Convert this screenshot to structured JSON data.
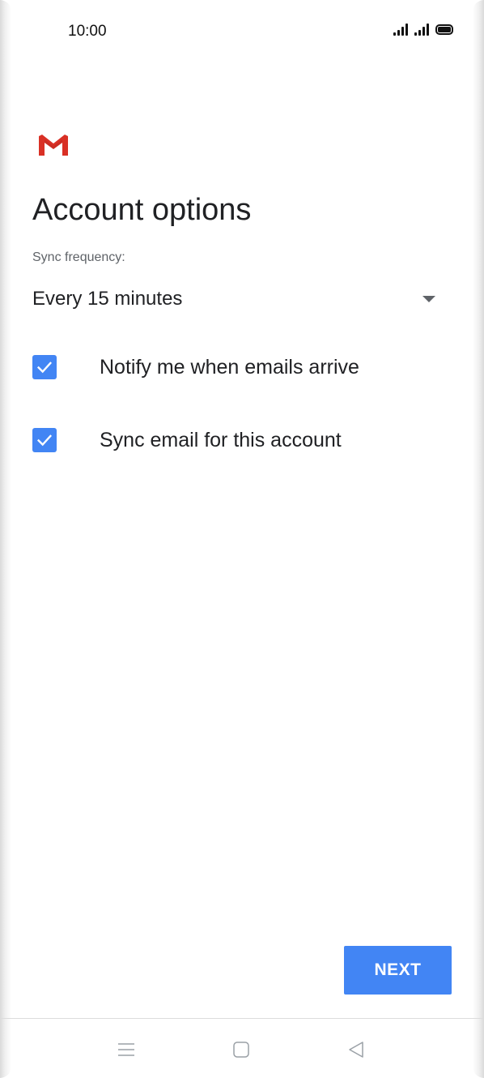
{
  "status_bar": {
    "time": "10:00"
  },
  "app": {
    "logo_icon": "gmail-icon",
    "title": "Account options"
  },
  "sync": {
    "label": "Sync frequency:",
    "selected": "Every 15 minutes"
  },
  "options": [
    {
      "label": "Notify me when emails arrive",
      "checked": true
    },
    {
      "label": "Sync email for this account",
      "checked": true
    }
  ],
  "actions": {
    "next_label": "NEXT"
  },
  "colors": {
    "accent": "#4285f4",
    "gmail_red": "#d93025",
    "text_primary": "#202124",
    "text_secondary": "#5f6368"
  },
  "nav_bar": {
    "icons": [
      "menu-icon",
      "home-icon",
      "back-icon"
    ]
  }
}
